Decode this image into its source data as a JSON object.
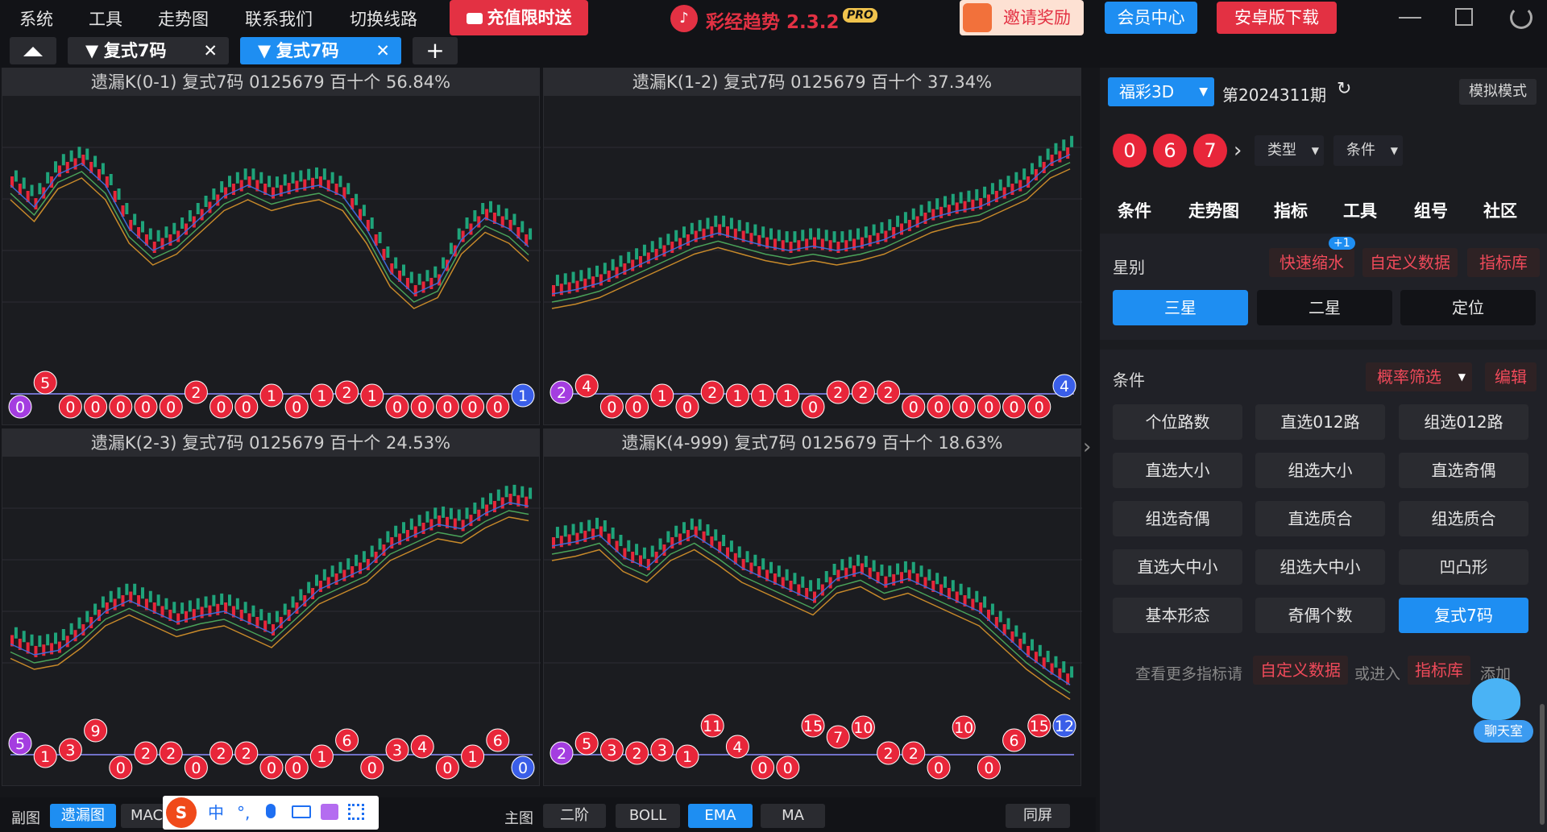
{
  "menu": [
    "系统",
    "工具",
    "走势图",
    "联系我们",
    "切换线路"
  ],
  "promo": "充值限时送",
  "app": {
    "title": "彩经趋势 2.3.2",
    "badge": "PRO"
  },
  "invite": "邀请奖励",
  "member": "会员中心",
  "android": "安卓版下载",
  "tabs": [
    "复式7码",
    "复式7码"
  ],
  "charts": [
    {
      "title": "遗漏K(0-1)  复式7码  0125679  百十个  56.84%"
    },
    {
      "title": "遗漏K(1-2)  复式7码  0125679  百十个  37.34%"
    },
    {
      "title": "遗漏K(2-3)  复式7码  0125679  百十个  24.53%"
    },
    {
      "title": "遗漏K(4-999)  复式7码  0125679  百十个  18.63%"
    }
  ],
  "sub": [
    [
      0,
      5,
      0,
      0,
      0,
      0,
      0,
      2,
      0,
      0,
      1,
      0,
      1,
      2,
      1,
      0,
      0,
      0,
      0,
      0,
      1
    ],
    [
      2,
      4,
      0,
      0,
      1,
      0,
      2,
      1,
      1,
      1,
      0,
      2,
      2,
      2,
      0,
      0,
      0,
      0,
      0,
      0,
      4
    ],
    [
      5,
      1,
      3,
      9,
      0,
      2,
      2,
      0,
      2,
      2,
      0,
      0,
      1,
      6,
      0,
      3,
      4,
      0,
      1,
      6,
      0
    ],
    [
      2,
      5,
      3,
      2,
      3,
      1,
      11,
      4,
      0,
      0,
      15,
      7,
      10,
      2,
      2,
      0,
      10,
      0,
      6,
      15,
      12
    ]
  ],
  "bottom": {
    "fu": "副图",
    "yl": "遗漏图",
    "macd": "MACD",
    "main": "主图",
    "er": "二阶",
    "boll": "BOLL",
    "ema": "EMA",
    "ma": "MA",
    "tp": "同屏"
  },
  "ime": "中",
  "side": {
    "lottery": "福彩3D",
    "period": "第2024311期",
    "mode": "模拟模式",
    "balls": [
      "0",
      "6",
      "7"
    ],
    "type": "类型",
    "cond": "条件",
    "navs": [
      "条件",
      "走势图",
      "指标",
      "工具",
      "组号",
      "社区"
    ],
    "star_label": "星别",
    "fast": "快速缩水",
    "plus": "+1",
    "custom": "自定义数据",
    "lib": "指标库",
    "stars": [
      "三星",
      "二星",
      "定位"
    ],
    "cond_label": "条件",
    "filter": "概率筛选",
    "edit": "编辑",
    "grid": [
      "个位路数",
      "直选012路",
      "组选012路",
      "直选大小",
      "组选大小",
      "直选奇偶",
      "组选奇偶",
      "直选质合",
      "组选质合",
      "直选大中小",
      "组选大中小",
      "凹凸形",
      "基本形态",
      "奇偶个数",
      "复式7码"
    ],
    "more": "查看更多指标请",
    "more2": "或进入",
    "more3": "添加",
    "chat": "聊天室"
  }
}
